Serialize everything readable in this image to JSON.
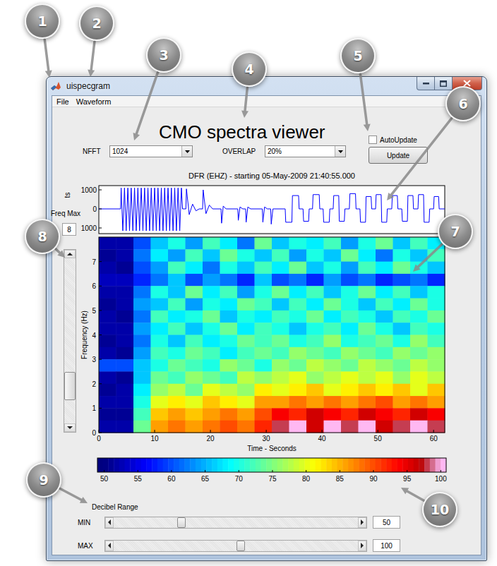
{
  "callouts": [
    "1",
    "2",
    "3",
    "4",
    "5",
    "6",
    "7",
    "8",
    "9",
    "10"
  ],
  "window": {
    "title": "uispecgram"
  },
  "menu": [
    "File",
    "Waveform"
  ],
  "heading": "CMO spectra viewer",
  "nfft": {
    "label": "NFFT",
    "value": "1024"
  },
  "overlap": {
    "label": "OVERLAP",
    "value": "20%"
  },
  "auto_update": {
    "label": "AutoUpdate",
    "checked": false
  },
  "update_button": "Update",
  "plot_title": "DFR (EHZ) - starting 05-May-2009 21:40:55.000",
  "freq_max": {
    "label": "Freq Max",
    "value": "8",
    "level": 0.17
  },
  "waveform": {
    "y_label": "ts",
    "time_max": 62,
    "y_ticks": [
      {
        "label": "1000",
        "value": 1000
      },
      {
        "label": "0",
        "value": 0
      },
      {
        "label": "1000",
        "value": -1000
      }
    ],
    "points": [
      [
        0,
        0
      ],
      [
        3.9,
        0
      ],
      [
        4.0,
        1100
      ],
      [
        4.3,
        -1150
      ],
      [
        4.6,
        1100
      ],
      [
        4.9,
        -1150
      ],
      [
        5.2,
        1100
      ],
      [
        5.5,
        -1150
      ],
      [
        5.8,
        1100
      ],
      [
        6.1,
        -1150
      ],
      [
        6.4,
        1100
      ],
      [
        6.7,
        -1150
      ],
      [
        7.0,
        1100
      ],
      [
        7.3,
        -1150
      ],
      [
        7.6,
        1100
      ],
      [
        7.9,
        -1150
      ],
      [
        8.2,
        1100
      ],
      [
        8.5,
        -1150
      ],
      [
        8.8,
        1100
      ],
      [
        9.1,
        -1150
      ],
      [
        9.4,
        1100
      ],
      [
        9.7,
        -1150
      ],
      [
        10.0,
        1100
      ],
      [
        10.3,
        -1150
      ],
      [
        10.6,
        1100
      ],
      [
        10.9,
        -1150
      ],
      [
        11.2,
        1100
      ],
      [
        11.5,
        -1150
      ],
      [
        11.8,
        1100
      ],
      [
        12.1,
        -1150
      ],
      [
        12.4,
        1100
      ],
      [
        12.7,
        -1150
      ],
      [
        13.0,
        1100
      ],
      [
        13.3,
        -1150
      ],
      [
        13.6,
        1100
      ],
      [
        13.9,
        -1150
      ],
      [
        14.2,
        1100
      ],
      [
        14.5,
        -1150
      ],
      [
        14.8,
        1100
      ],
      [
        15.0,
        0
      ],
      [
        15.6,
        0
      ],
      [
        15.7,
        1050
      ],
      [
        16.2,
        -300
      ],
      [
        16.8,
        250
      ],
      [
        17.4,
        -100
      ],
      [
        18.0,
        0
      ],
      [
        18.6,
        0
      ],
      [
        18.7,
        1000
      ],
      [
        19.2,
        -250
      ],
      [
        19.8,
        200
      ],
      [
        20.4,
        0
      ],
      [
        21.9,
        0
      ],
      [
        22.0,
        -750
      ],
      [
        22.3,
        150
      ],
      [
        22.8,
        0
      ],
      [
        24.9,
        0
      ],
      [
        25.0,
        -600
      ],
      [
        25.3,
        100
      ],
      [
        25.8,
        0
      ],
      [
        26.3,
        0
      ],
      [
        26.4,
        -700
      ],
      [
        26.7,
        100
      ],
      [
        27.2,
        0
      ],
      [
        29.3,
        0
      ],
      [
        29.4,
        -700
      ],
      [
        29.7,
        100
      ],
      [
        30.2,
        0
      ],
      [
        30.8,
        0
      ],
      [
        30.9,
        -800
      ],
      [
        31.2,
        0
      ],
      [
        33.4,
        0
      ],
      [
        33.5,
        -700
      ],
      [
        34.6,
        -700
      ],
      [
        34.7,
        700
      ],
      [
        35.8,
        700
      ],
      [
        35.9,
        0
      ],
      [
        36.6,
        0
      ],
      [
        36.7,
        -650
      ],
      [
        37.6,
        -650
      ],
      [
        37.7,
        0
      ],
      [
        38.3,
        0
      ],
      [
        38.4,
        750
      ],
      [
        39.5,
        750
      ],
      [
        39.6,
        0
      ],
      [
        40.2,
        0
      ],
      [
        40.3,
        -700
      ],
      [
        41.3,
        -700
      ],
      [
        41.4,
        0
      ],
      [
        42.0,
        0
      ],
      [
        42.1,
        700
      ],
      [
        43.0,
        700
      ],
      [
        43.1,
        -650
      ],
      [
        44.0,
        -650
      ],
      [
        44.1,
        0
      ],
      [
        44.9,
        0
      ],
      [
        45.0,
        800
      ],
      [
        46.0,
        800
      ],
      [
        46.1,
        0
      ],
      [
        46.8,
        0
      ],
      [
        46.9,
        -700
      ],
      [
        47.8,
        -700
      ],
      [
        47.9,
        650
      ],
      [
        48.8,
        650
      ],
      [
        48.9,
        0
      ],
      [
        49.6,
        0
      ],
      [
        49.7,
        750
      ],
      [
        50.6,
        750
      ],
      [
        50.7,
        -700
      ],
      [
        51.6,
        -700
      ],
      [
        51.7,
        0
      ],
      [
        52.5,
        0
      ],
      [
        52.6,
        700
      ],
      [
        53.5,
        700
      ],
      [
        53.6,
        0
      ],
      [
        54.3,
        0
      ],
      [
        54.4,
        -650
      ],
      [
        55.3,
        -650
      ],
      [
        55.4,
        700
      ],
      [
        56.3,
        700
      ],
      [
        56.4,
        0
      ],
      [
        57.2,
        0
      ],
      [
        57.3,
        750
      ],
      [
        58.2,
        750
      ],
      [
        58.3,
        -700
      ],
      [
        59.2,
        -700
      ],
      [
        59.3,
        0
      ],
      [
        60.0,
        0
      ],
      [
        60.1,
        650
      ],
      [
        60.9,
        650
      ],
      [
        61.0,
        0
      ],
      [
        62,
        0
      ]
    ]
  },
  "spectrogram": {
    "y_label": "Frequency (Hz)",
    "x_label": "Time - Seconds",
    "freq_max": 8,
    "time_max": 62,
    "y_ticks": [
      "0",
      "1",
      "2",
      "3",
      "4",
      "5",
      "6",
      "7"
    ],
    "x_ticks": [
      "0",
      "10",
      "20",
      "30",
      "40",
      "50",
      "60"
    ],
    "db_rows_top_to_bottom": [
      [
        52,
        52,
        60,
        66,
        70,
        64,
        72,
        68,
        62,
        74,
        66,
        70,
        68,
        72,
        64,
        70,
        74,
        66,
        72,
        68
      ],
      [
        51,
        52,
        62,
        68,
        64,
        72,
        66,
        74,
        70,
        66,
        72,
        64,
        70,
        66,
        74,
        68,
        62,
        70,
        66,
        72
      ],
      [
        52,
        51,
        60,
        64,
        72,
        68,
        62,
        70,
        66,
        72,
        68,
        74,
        66,
        70,
        64,
        72,
        68,
        74,
        70,
        66
      ],
      [
        53,
        53,
        58,
        62,
        66,
        60,
        64,
        62,
        58,
        66,
        60,
        62,
        58,
        64,
        60,
        62,
        58,
        60,
        62,
        58
      ],
      [
        52,
        52,
        62,
        70,
        66,
        74,
        68,
        72,
        64,
        70,
        74,
        68,
        72,
        66,
        70,
        74,
        68,
        72,
        66,
        70
      ],
      [
        51,
        52,
        64,
        66,
        72,
        64,
        70,
        68,
        74,
        72,
        66,
        72,
        68,
        74,
        70,
        66,
        72,
        68,
        74,
        70
      ],
      [
        52,
        51,
        62,
        72,
        68,
        70,
        74,
        66,
        70,
        68,
        72,
        70,
        74,
        68,
        72,
        70,
        66,
        72,
        70,
        74
      ],
      [
        52,
        52,
        64,
        68,
        72,
        66,
        70,
        74,
        68,
        72,
        70,
        66,
        70,
        72,
        68,
        74,
        70,
        66,
        72,
        70
      ],
      [
        51,
        52,
        62,
        70,
        66,
        72,
        68,
        70,
        74,
        72,
        74,
        70,
        72,
        76,
        70,
        72,
        74,
        70,
        76,
        72
      ],
      [
        52,
        51,
        64,
        72,
        70,
        74,
        72,
        68,
        72,
        74,
        72,
        76,
        74,
        72,
        76,
        74,
        72,
        76,
        74,
        76
      ],
      [
        60,
        60,
        66,
        70,
        74,
        72,
        70,
        76,
        74,
        70,
        76,
        74,
        78,
        76,
        74,
        78,
        76,
        74,
        78,
        76
      ],
      [
        52,
        51,
        66,
        74,
        72,
        76,
        74,
        72,
        78,
        76,
        78,
        80,
        76,
        78,
        80,
        78,
        80,
        76,
        80,
        78
      ],
      [
        51,
        52,
        68,
        76,
        78,
        74,
        80,
        78,
        76,
        82,
        80,
        82,
        84,
        80,
        82,
        84,
        82,
        84,
        80,
        84
      ],
      [
        52,
        52,
        70,
        80,
        82,
        80,
        84,
        82,
        80,
        86,
        86,
        88,
        86,
        88,
        86,
        88,
        90,
        86,
        88,
        86
      ],
      [
        51,
        51,
        72,
        84,
        86,
        84,
        86,
        88,
        86,
        90,
        94,
        92,
        96,
        94,
        92,
        96,
        94,
        92,
        96,
        94
      ],
      [
        52,
        52,
        74,
        86,
        88,
        86,
        88,
        90,
        88,
        92,
        98,
        100,
        96,
        100,
        98,
        100,
        96,
        98,
        100,
        98
      ]
    ]
  },
  "colorbar": {
    "domain": [
      49,
      100.8
    ],
    "ticks": [
      "50",
      "55",
      "60",
      "65",
      "70",
      "75",
      "80",
      "85",
      "90",
      "95",
      "100"
    ]
  },
  "decibel_range": {
    "label": "Decibel Range",
    "sliders": [
      {
        "label": "MIN",
        "value": "50",
        "level": 0.27
      },
      {
        "label": "MAX",
        "value": "100",
        "level": 0.52
      }
    ]
  }
}
